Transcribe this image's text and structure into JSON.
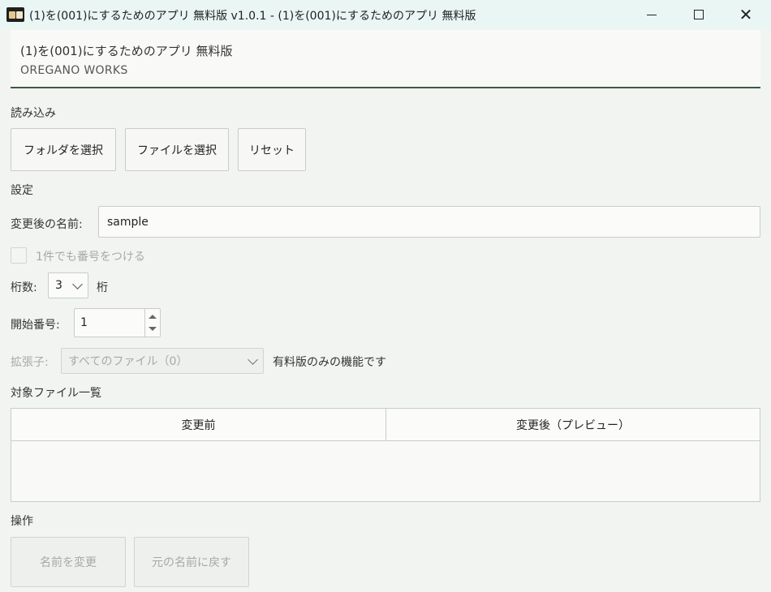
{
  "window": {
    "title": "(1)を(001)にするためのアプリ 無料版 v1.0.1 - (1)を(001)にするためのアプリ 無料版",
    "controls": [
      "minimize-icon",
      "maximize-icon",
      "close-icon"
    ]
  },
  "header": {
    "title": "(1)を(001)にするためのアプリ 無料版",
    "subtitle": "OREGANO WORKS"
  },
  "load_section": {
    "label": "読み込み",
    "buttons": {
      "select_folder": "フォルダを選択",
      "select_file": "ファイルを選択",
      "reset": "リセット"
    }
  },
  "settings_section": {
    "label": "設定",
    "new_name_label": "変更後の名前:",
    "new_name_value": "sample",
    "number_even_one_label": "1件でも番号をつける",
    "number_even_one_checked": false,
    "digits_label": "桁数:",
    "digits_value": "3",
    "digits_unit": "桁",
    "start_number_label": "開始番号:",
    "start_number_value": "1",
    "extension_label": "拡張子:",
    "extension_value": "すべてのファイル（0）",
    "extension_note": "有料版のみの機能です"
  },
  "file_list": {
    "label": "対象ファイル一覧",
    "columns": [
      "変更前",
      "変更後（プレビュー）"
    ],
    "rows": []
  },
  "operations": {
    "label": "操作",
    "rename_button": "名前を変更",
    "restore_button": "元の名前に戻す"
  },
  "colors": {
    "titlebar_bg": "#eaf6f4",
    "body_bg": "#f2f4f1",
    "header_rule": "#3d5a47"
  }
}
